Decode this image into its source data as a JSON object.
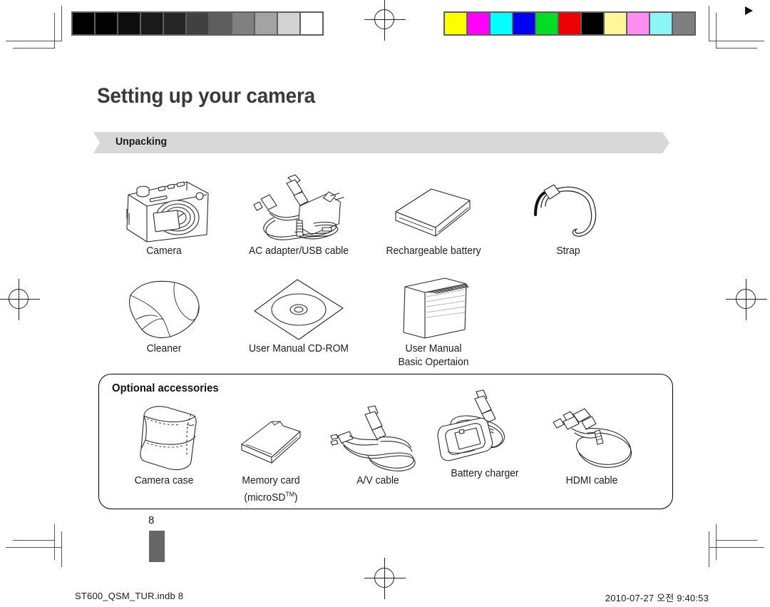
{
  "document": {
    "page_title": "Setting up your camera",
    "page_number": "8",
    "footer_left": "ST600_QSM_TUR.indb   8",
    "footer_right": "2010-07-27   오전 9:40:53"
  },
  "section": {
    "banner_label": "Unpacking",
    "banner_color": "#d8d8d8",
    "arrow_icon": "triangle-right-icon"
  },
  "unpacking": {
    "row1": [
      {
        "icon": "camera-icon",
        "label": "Camera"
      },
      {
        "icon": "ac-adapter-usb-cable-icon",
        "label": "AC adapter/USB cable"
      },
      {
        "icon": "battery-icon",
        "label": "Rechargeable battery"
      },
      {
        "icon": "strap-icon",
        "label": "Strap"
      }
    ],
    "row2": [
      {
        "icon": "cleaner-cloth-icon",
        "label": "Cleaner"
      },
      {
        "icon": "cd-rom-icon",
        "label": "User Manual CD-ROM"
      },
      {
        "icon": "user-manual-icon",
        "label": "User Manual",
        "label2": "Basic Opertaion"
      }
    ]
  },
  "optional": {
    "title": "Optional accessories",
    "items": [
      {
        "icon": "camera-case-icon",
        "label": "Camera case"
      },
      {
        "icon": "memory-card-icon",
        "label": "Memory card",
        "label2_pre": "(microSD",
        "label2_sup": "TM",
        "label2_post": ")"
      },
      {
        "icon": "av-cable-icon",
        "label": "A/V cable"
      },
      {
        "icon": "battery-charger-icon",
        "label": "Battery charger"
      },
      {
        "icon": "hdmi-cable-icon",
        "label": "HDMI cable"
      }
    ]
  },
  "calibration": {
    "grayscale": [
      "#000000",
      "#020202",
      "#0d0d0d",
      "#1a1a1a",
      "#262626",
      "#414141",
      "#5e5e5e",
      "#808080",
      "#a3a3a3",
      "#d2d2d2",
      "#ffffff"
    ],
    "colors": [
      "#ffff00",
      "#ff00ff",
      "#00ffff",
      "#0000ee",
      "#00dd22",
      "#ee0000",
      "#000000",
      "#fdf79a",
      "#ff8cf0",
      "#8cf6f6",
      "#7f7f7f"
    ]
  }
}
